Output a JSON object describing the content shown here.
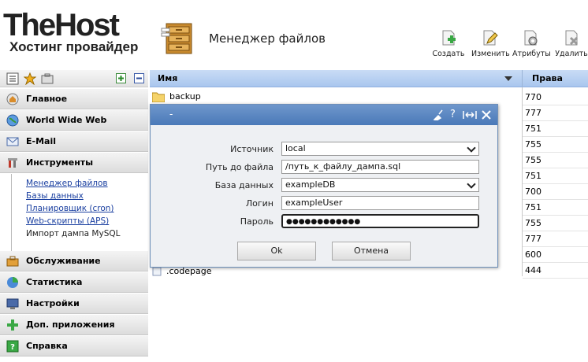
{
  "logo": {
    "title": "TheHost",
    "subtitle": "Хостинг провайдер"
  },
  "page_title": "Менеджер файлов",
  "toolbar": [
    {
      "label": "Создать",
      "icon": "create-file-icon"
    },
    {
      "label": "Изменить",
      "icon": "edit-file-icon"
    },
    {
      "label": "Атрибуты",
      "icon": "attributes-icon"
    },
    {
      "label": "Удалить",
      "icon": "delete-file-icon"
    }
  ],
  "nav": {
    "top_items": [
      {
        "label": "Главное",
        "icon": "home-icon"
      },
      {
        "label": "World Wide Web",
        "icon": "globe-icon"
      },
      {
        "label": "E-Mail",
        "icon": "mail-icon"
      },
      {
        "label": "Инструменты",
        "icon": "tools-icon"
      }
    ],
    "tools_sub": [
      "Менеджер файлов",
      "Базы данных",
      "Планировщик (cron)",
      "Web-скрипты (APS)",
      "Импорт дампа MySQL"
    ],
    "bottom_items": [
      {
        "label": "Обслуживание",
        "icon": "service-icon"
      },
      {
        "label": "Статистика",
        "icon": "stats-icon"
      },
      {
        "label": "Настройки",
        "icon": "settings-icon"
      },
      {
        "label": "Доп. приложения",
        "icon": "add-apps-icon"
      },
      {
        "label": "Справка",
        "icon": "help-icon"
      }
    ]
  },
  "table": {
    "col_name": "Имя",
    "col_rights": "Права",
    "first_row": "backup",
    "last_row": ".codepage",
    "rights": [
      "770",
      "777",
      "751",
      "755",
      "755",
      "751",
      "700",
      "751",
      "755",
      "777",
      "600",
      "444"
    ]
  },
  "dialog": {
    "title": "-",
    "fields": [
      {
        "label": "Источник",
        "value": "local",
        "type": "select"
      },
      {
        "label": "Путь до файла",
        "value": "/путь_к_файлу_дампа.sql",
        "type": "text"
      },
      {
        "label": "База данных",
        "value": "exampleDB",
        "type": "select"
      },
      {
        "label": "Логин",
        "value": "exampleUser",
        "type": "text"
      },
      {
        "label": "Пароль",
        "value": "●●●●●●●●●●●●",
        "type": "password"
      }
    ],
    "ok_label": "Ok",
    "cancel_label": "Отмена"
  },
  "colors": {
    "header_blue": "#4a79b8",
    "table_head": "#b9d1f2",
    "link": "#1a3fa0"
  }
}
